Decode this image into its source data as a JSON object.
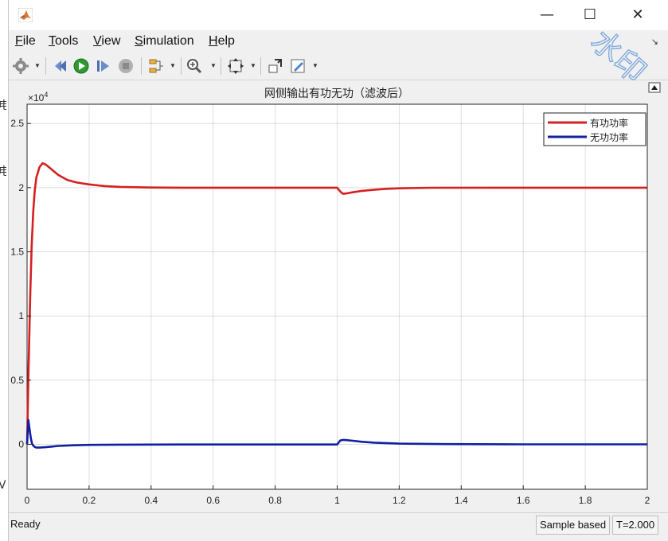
{
  "window": {
    "menu": [
      {
        "key": "F",
        "rest": "ile"
      },
      {
        "key": "T",
        "rest": "ools"
      },
      {
        "key": "V",
        "rest": "iew"
      },
      {
        "key": "S",
        "rest": "imulation"
      },
      {
        "key": "H",
        "rest": "elp"
      }
    ],
    "controls": {
      "minimize": "—",
      "maximize": "☐",
      "close": "✕"
    }
  },
  "toolbar": {
    "icons": [
      "gear-icon",
      "step-back-icon",
      "run-icon",
      "step-forward-icon",
      "stop-icon",
      "signal-selector-icon",
      "zoom-icon",
      "fit-to-view-icon",
      "highlight-block-icon",
      "style-icon"
    ]
  },
  "watermark": {
    "text": "水印"
  },
  "status": {
    "ready": "Ready",
    "sample_mode": "Sample based",
    "time": "T=2.000"
  },
  "chart_data": {
    "type": "line",
    "title": "网侧输出有功无功（滤波后）",
    "xlabel": "",
    "ylabel": "",
    "y_exponent_label": "×10",
    "y_exponent": "4",
    "xlim": [
      0,
      2
    ],
    "ylim": [
      -0.35,
      2.65
    ],
    "x_ticks": [
      0,
      0.2,
      0.4,
      0.6,
      0.8,
      1,
      1.2,
      1.4,
      1.6,
      1.8,
      2
    ],
    "x_tick_labels": [
      "0",
      "0.2",
      "0.4",
      "0.6",
      "0.8",
      "1",
      "1.2",
      "1.4",
      "1.6",
      "1.8",
      "2"
    ],
    "y_ticks": [
      0,
      0.5,
      1,
      1.5,
      2,
      2.5
    ],
    "y_tick_labels": [
      "0",
      "0.5",
      "1",
      "1.5",
      "2",
      "2.5"
    ],
    "grid": true,
    "legend_position": "top-right",
    "series": [
      {
        "name": "有功功率",
        "color": "#d42020",
        "x": [
          0,
          0.005,
          0.01,
          0.015,
          0.02,
          0.025,
          0.03,
          0.04,
          0.05,
          0.06,
          0.08,
          0.1,
          0.13,
          0.16,
          0.2,
          0.25,
          0.3,
          0.4,
          0.5,
          0.7,
          1.0,
          1.005,
          1.01,
          1.015,
          1.02,
          1.03,
          1.05,
          1.08,
          1.12,
          1.16,
          1.2,
          1.3,
          1.5,
          2.0
        ],
        "y": [
          0,
          0.6,
          1.15,
          1.55,
          1.82,
          1.98,
          2.08,
          2.16,
          2.19,
          2.18,
          2.14,
          2.1,
          2.06,
          2.04,
          2.025,
          2.012,
          2.006,
          2.001,
          2.0,
          2.0,
          2.0,
          1.985,
          1.97,
          1.958,
          1.952,
          1.955,
          1.964,
          1.975,
          1.984,
          1.991,
          1.995,
          1.999,
          2.0,
          2.0
        ]
      },
      {
        "name": "无功功率",
        "color": "#1020a0",
        "x": [
          0,
          0.004,
          0.008,
          0.012,
          0.016,
          0.02,
          0.025,
          0.03,
          0.04,
          0.06,
          0.08,
          0.1,
          0.15,
          0.2,
          0.3,
          0.5,
          1.0,
          1.005,
          1.01,
          1.02,
          1.03,
          1.05,
          1.08,
          1.12,
          1.2,
          1.35,
          1.6,
          2.0
        ],
        "y": [
          0,
          0.19,
          0.12,
          0.05,
          0.005,
          -0.01,
          -0.02,
          -0.025,
          -0.025,
          -0.022,
          -0.017,
          -0.012,
          -0.007,
          -0.004,
          -0.002,
          -0.001,
          -0.001,
          0.015,
          0.03,
          0.035,
          0.033,
          0.028,
          0.02,
          0.013,
          0.006,
          0.002,
          0.0,
          0.0
        ]
      }
    ]
  }
}
